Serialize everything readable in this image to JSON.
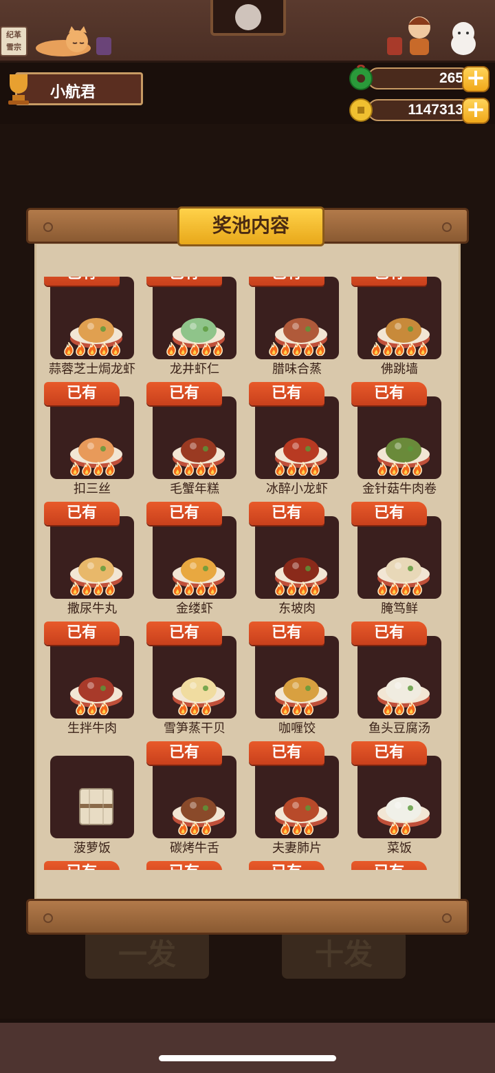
{
  "topbar": {
    "sign_text": "纪革\n雪宗"
  },
  "user": {
    "name": "小航君"
  },
  "currency": {
    "jade": {
      "icon": "jade-coin-icon",
      "value": "265"
    },
    "gold": {
      "icon": "gold-coin-icon",
      "value": "1147313"
    },
    "plus": "+"
  },
  "modal": {
    "title": "奖池内容",
    "owned_label": "已有"
  },
  "background": {
    "draw_one": "一发",
    "draw_ten": "十发"
  },
  "dishes": [
    {
      "name": "蒜蓉芝士焗龙虾",
      "owned": true,
      "flames": 5,
      "color": "#e0a050"
    },
    {
      "name": "龙井虾仁",
      "owned": true,
      "flames": 5,
      "color": "#8fc48a"
    },
    {
      "name": "腊味合蒸",
      "owned": true,
      "flames": 5,
      "color": "#b05a3a"
    },
    {
      "name": "佛跳墙",
      "owned": true,
      "flames": 5,
      "color": "#c88a3a"
    },
    {
      "name": "扣三丝",
      "owned": true,
      "flames": 4,
      "color": "#e89a5a"
    },
    {
      "name": "毛蟹年糕",
      "owned": true,
      "flames": 4,
      "color": "#9a3a22"
    },
    {
      "name": "冰醉小龙虾",
      "owned": true,
      "flames": 4,
      "color": "#b83a22"
    },
    {
      "name": "金针菇牛肉卷",
      "owned": true,
      "flames": 4,
      "color": "#6a8a3a"
    },
    {
      "name": "撒尿牛丸",
      "owned": true,
      "flames": 4,
      "color": "#e8b86a"
    },
    {
      "name": "金缕虾",
      "owned": true,
      "flames": 4,
      "color": "#e8a840"
    },
    {
      "name": "东坡肉",
      "owned": true,
      "flames": 4,
      "color": "#8a2a1a"
    },
    {
      "name": "腌笃鲜",
      "owned": true,
      "flames": 4,
      "color": "#e8d8b8"
    },
    {
      "name": "生拌牛肉",
      "owned": true,
      "flames": 3,
      "color": "#a83a2a"
    },
    {
      "name": "雪笋蒸干贝",
      "owned": true,
      "flames": 3,
      "color": "#f0dca0"
    },
    {
      "name": "咖喱饺",
      "owned": true,
      "flames": 3,
      "color": "#d8a040"
    },
    {
      "name": "鱼头豆腐汤",
      "owned": true,
      "flames": 3,
      "color": "#f0ece0"
    },
    {
      "name": "菠萝饭",
      "owned": false,
      "flames": 0,
      "color": "#d8d0c0"
    },
    {
      "name": "碳烤牛舌",
      "owned": true,
      "flames": 3,
      "color": "#8a4a2a"
    },
    {
      "name": "夫妻肺片",
      "owned": true,
      "flames": 3,
      "color": "#b84a2a"
    },
    {
      "name": "菜饭",
      "owned": true,
      "flames": 2,
      "color": "#f0f0e8"
    },
    {
      "name": "",
      "owned": true,
      "flames": 0,
      "color": "#000000"
    },
    {
      "name": "",
      "owned": true,
      "flames": 0,
      "color": "#000000"
    },
    {
      "name": "",
      "owned": true,
      "flames": 0,
      "color": "#000000"
    },
    {
      "name": "",
      "owned": true,
      "flames": 0,
      "color": "#000000"
    }
  ]
}
